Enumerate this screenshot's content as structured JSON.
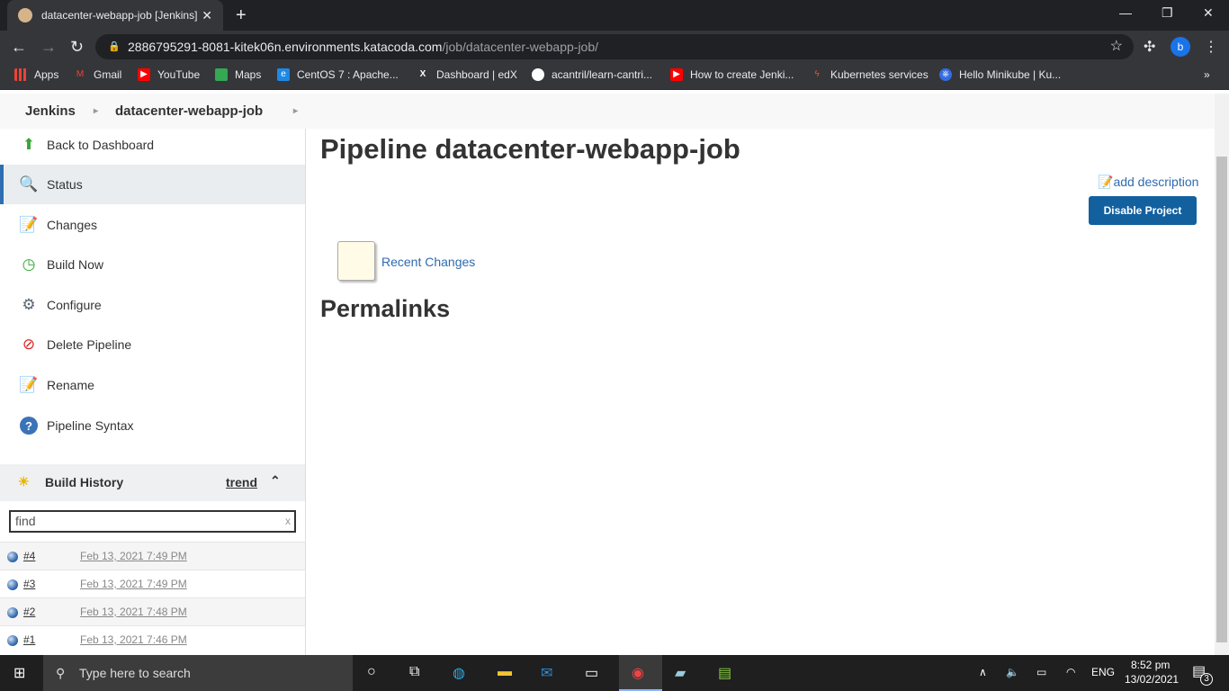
{
  "browser": {
    "tab_title": "datacenter-webapp-job [Jenkins]",
    "url_host": "2886795291-8081-kitek06n.environments.katacoda.com",
    "url_path": "/job/datacenter-webapp-job/",
    "profile": "b",
    "bookmarks": [
      {
        "label": "Apps",
        "color": "#ea4335"
      },
      {
        "label": "Gmail",
        "color": "#ea4335"
      },
      {
        "label": "YouTube",
        "color": "#ff0000"
      },
      {
        "label": "Maps",
        "color": "#34a853"
      },
      {
        "label": "CentOS 7 : Apache...",
        "color": "#1e88e5"
      },
      {
        "label": "Dashboard | edX",
        "color": "#202124"
      },
      {
        "label": "acantril/learn-cantri...",
        "color": "#ffffff"
      },
      {
        "label": "How to create Jenki...",
        "color": "#ff0000"
      },
      {
        "label": "Kubernetes services",
        "color": "#e8582a"
      },
      {
        "label": "Hello Minikube | Ku...",
        "color": "#326ce5"
      }
    ]
  },
  "breadcrumb": [
    "Jenkins",
    "datacenter-webapp-job"
  ],
  "sidebar": {
    "tasks": [
      {
        "label": "Back to Dashboard",
        "icon": "arrow-up-icon"
      },
      {
        "label": "Status",
        "icon": "search-icon"
      },
      {
        "label": "Changes",
        "icon": "notepad-icon"
      },
      {
        "label": "Build Now",
        "icon": "clock-icon"
      },
      {
        "label": "Configure",
        "icon": "gear-icon"
      },
      {
        "label": "Delete Pipeline",
        "icon": "no-entry-icon"
      },
      {
        "label": "Rename",
        "icon": "notepad-icon"
      },
      {
        "label": "Pipeline Syntax",
        "icon": "help-icon"
      }
    ],
    "build_history": {
      "title": "Build History",
      "trend": "trend",
      "filter_placeholder": "find",
      "builds": [
        {
          "num": "#4",
          "date": "Feb 13, 2021 7:49 PM"
        },
        {
          "num": "#3",
          "date": "Feb 13, 2021 7:49 PM"
        },
        {
          "num": "#2",
          "date": "Feb 13, 2021 7:48 PM"
        },
        {
          "num": "#1",
          "date": "Feb 13, 2021 7:46 PM"
        }
      ]
    }
  },
  "main": {
    "title": "Pipeline datacenter-webapp-job",
    "add_description": "add description",
    "disable_button": "Disable Project",
    "recent_changes": "Recent Changes",
    "permalinks": "Permalinks"
  },
  "taskbar": {
    "search_placeholder": "Type here to search",
    "lang": "ENG",
    "time": "8:52 pm",
    "date": "13/02/2021",
    "notifications": "3"
  }
}
